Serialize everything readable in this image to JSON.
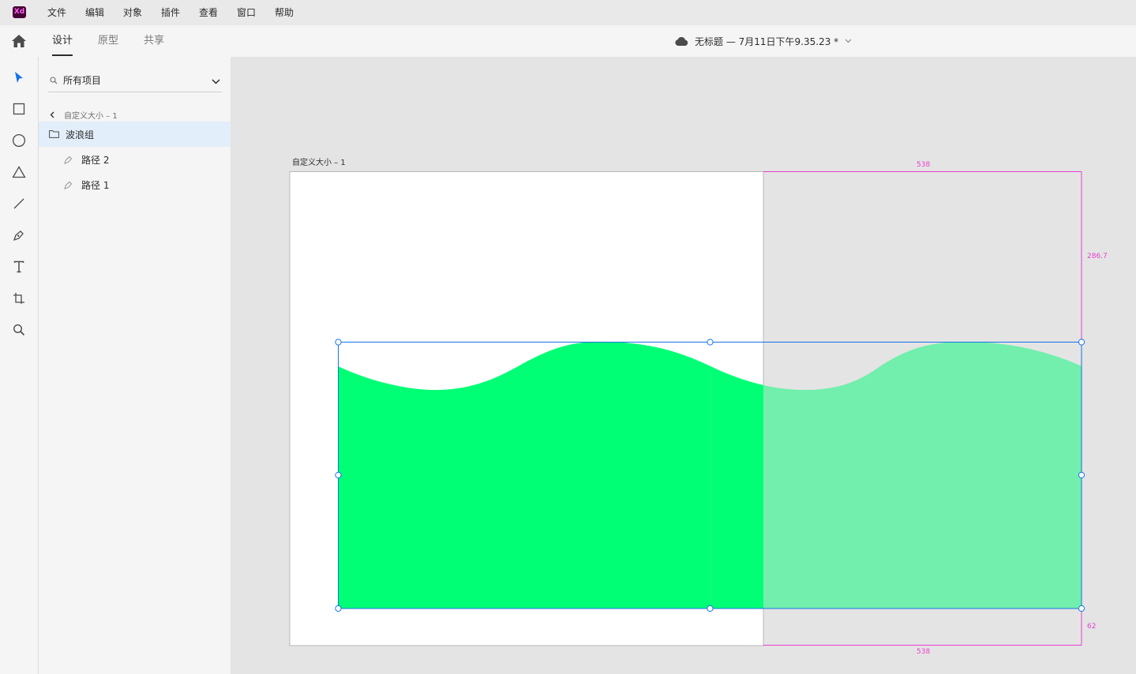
{
  "menu": {
    "app_logo": "Xd",
    "items": [
      "文件",
      "编辑",
      "对象",
      "插件",
      "查看",
      "窗口",
      "帮助"
    ]
  },
  "header": {
    "tabs": [
      "设计",
      "原型",
      "共享"
    ],
    "active_tab": "设计",
    "doc_title": "无标题 — 7月11日下午9.35.23 *"
  },
  "tools": [
    "select-tool",
    "rectangle-tool",
    "ellipse-tool",
    "polygon-tool",
    "line-tool",
    "pen-tool",
    "text-tool",
    "artboard-tool",
    "zoom-tool"
  ],
  "layers": {
    "search_label": "所有项目",
    "breadcrumb": "自定义大小 – 1",
    "items": [
      {
        "label": "波浪组",
        "type": "group",
        "selected": true
      },
      {
        "label": "路径 2",
        "type": "path",
        "selected": false
      },
      {
        "label": "路径 1",
        "type": "path",
        "selected": false
      }
    ]
  },
  "canvas": {
    "artboard_title": "自定义大小 – 1",
    "measure_top": "538",
    "measure_right": "286.7",
    "measure_bottom_right": "62",
    "measure_bottom": "538"
  },
  "colors": {
    "accent": "#1473e6",
    "wave_inside": "#00ff75",
    "wave_outside": "#72efac",
    "measure": "#e83ed0"
  }
}
